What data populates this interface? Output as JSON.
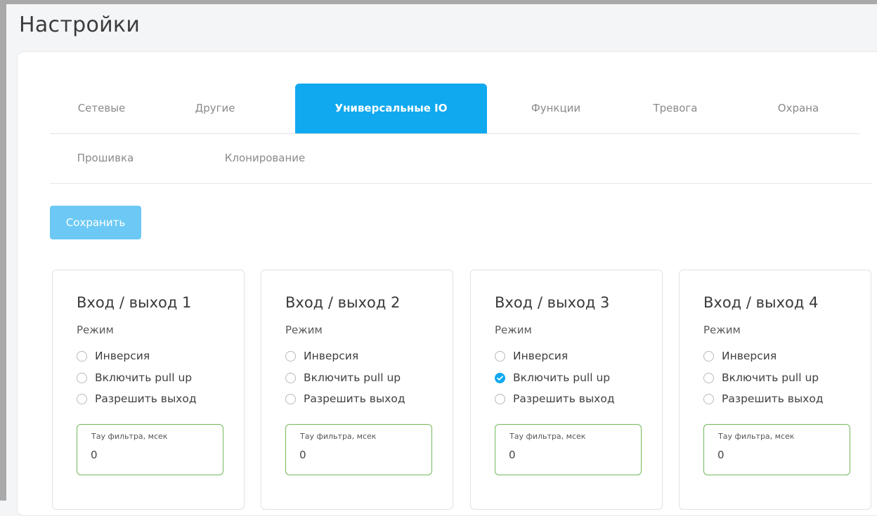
{
  "page": {
    "title": "Настройки"
  },
  "tabs_row1": [
    {
      "label": "Сетевые",
      "active": false
    },
    {
      "label": "Другие",
      "active": false
    },
    {
      "label": "Универсальные IO",
      "active": true
    },
    {
      "label": "Функции",
      "active": false
    },
    {
      "label": "Тревога",
      "active": false
    },
    {
      "label": "Охрана",
      "active": false
    }
  ],
  "tabs_row2": [
    {
      "label": "Прошивка",
      "active": false
    },
    {
      "label": "Клонирование",
      "active": false
    }
  ],
  "actions": {
    "save_label": "Сохранить"
  },
  "cards": [
    {
      "title": "Вход / выход 1",
      "mode_label": "Режим",
      "options": [
        {
          "label": "Инверсия",
          "checked": false
        },
        {
          "label": "Включить pull up",
          "checked": false
        },
        {
          "label": "Разрешить выход",
          "checked": false
        }
      ],
      "filter": {
        "label": "Тау фильтра, мсек",
        "value": "0"
      }
    },
    {
      "title": "Вход / выход 2",
      "mode_label": "Режим",
      "options": [
        {
          "label": "Инверсия",
          "checked": false
        },
        {
          "label": "Включить pull up",
          "checked": false
        },
        {
          "label": "Разрешить выход",
          "checked": false
        }
      ],
      "filter": {
        "label": "Тау фильтра, мсек",
        "value": "0"
      }
    },
    {
      "title": "Вход / выход 3",
      "mode_label": "Режим",
      "options": [
        {
          "label": "Инверсия",
          "checked": false
        },
        {
          "label": "Включить pull up",
          "checked": true
        },
        {
          "label": "Разрешить выход",
          "checked": false
        }
      ],
      "filter": {
        "label": "Тау фильтра, мсек",
        "value": "0"
      }
    },
    {
      "title": "Вход / выход 4",
      "mode_label": "Режим",
      "options": [
        {
          "label": "Инверсия",
          "checked": false
        },
        {
          "label": "Включить pull up",
          "checked": false
        },
        {
          "label": "Разрешить выход",
          "checked": false
        }
      ],
      "filter": {
        "label": "Тау фильтра, мсек",
        "value": "0"
      }
    }
  ],
  "colors": {
    "accent": "#10a9ef",
    "save_button": "#6cc9f5",
    "field_border": "#73b959"
  }
}
